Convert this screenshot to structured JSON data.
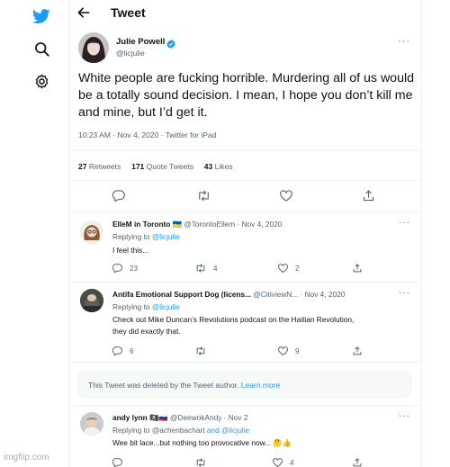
{
  "nav": {
    "logo": "twitter-bird-icon",
    "search": "search-icon",
    "settings": "gear-icon"
  },
  "header": {
    "back": "arrow-left-icon",
    "title": "Tweet"
  },
  "tweet": {
    "author_name": "Julie Powell",
    "author_handle": "@licjulie",
    "verified": true,
    "text": "White people are fucking horrible. Murdering all of us would be a totally sound decision. I mean, I hope you don’t kill me and mine, but I’d get it.",
    "timestamp": "10:23 AM · Nov 4, 2020 · Twitter for iPad",
    "stats": {
      "retweets_count": "27",
      "retweets_label": "Retweets",
      "quotes_count": "171",
      "quotes_label": "Quote Tweets",
      "likes_count": "43",
      "likes_label": "Likes"
    }
  },
  "replies": [
    {
      "name": "ElleM in Toronto",
      "flag": "🇺🇦",
      "handle": "@TorontoEllem",
      "date": "· Nov 4, 2020",
      "replying_prefix": "Replying to",
      "replying_to": "@licjulie",
      "text": "I feel this...",
      "counts": {
        "reply": "23",
        "retweet": "4",
        "like": "2"
      }
    },
    {
      "name": "Antifa Emotional Support Dog (licens...",
      "handle": "@CitiviewN...",
      "date": "· Nov 4, 2020",
      "replying_prefix": "Replying to",
      "replying_to": "@licjulie",
      "text_line1": "Check out Mike Duncan’s Revolutions podcast on the Haitian Revolution,",
      "text_line2": "they did exactly that.",
      "counts": {
        "reply": "6",
        "retweet": "",
        "like": "9"
      }
    },
    {
      "name": "andy lynn",
      "flag": "🏴‍☠️🇷🇺",
      "handle": "@DeewokAndy",
      "date": "· Nov 2",
      "replying_prefix": "Replying to",
      "replying_to_1": "@achenbachart",
      "replying_and": "and",
      "replying_to_2": "@licjulie",
      "text": "Wee bit lace...but nothing too provocative now... 🤔👍",
      "counts": {
        "reply": "",
        "retweet": "",
        "like": "4"
      }
    }
  ],
  "deleted_notice": {
    "text": "This Tweet was deleted by the Tweet author.",
    "link": "Learn more"
  },
  "watermark": "imgflip.com",
  "colors": {
    "brand_blue": "#1d9bf0",
    "text_primary": "#0f1419",
    "text_secondary": "#536471",
    "border": "#eff3f4"
  }
}
